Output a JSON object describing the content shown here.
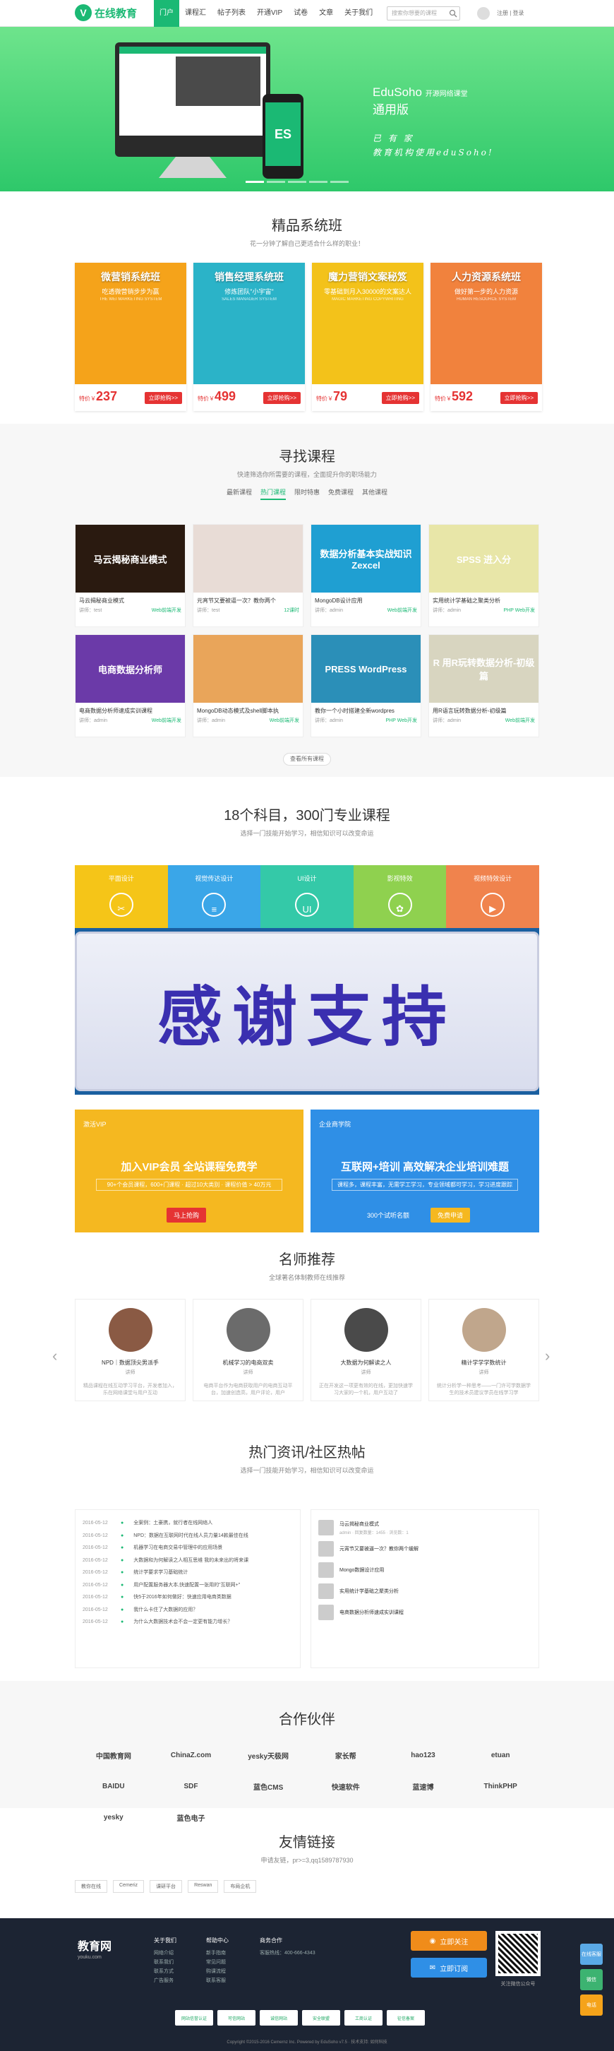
{
  "header": {
    "logo_mark": "V",
    "logo_text": "在线教育",
    "nav": [
      "门户",
      "课程汇",
      "帖子列表",
      "开通VIP",
      "试卷",
      "文章",
      "关于我们"
    ],
    "search_placeholder": "搜索你想要的课程",
    "login": "注册 | 登录"
  },
  "banner": {
    "title": "EduSoho",
    "title_small": "开源网络课堂",
    "title2": "通用版",
    "sign1": "已 有 家",
    "sign2": "教育机构使用eduSoho!",
    "phone_label": "ES"
  },
  "system": {
    "title": "精品系统班",
    "subtitle": "花一分钟了解自己更适合什么样的职业！",
    "cards": [
      {
        "t": "微营销系统班",
        "s": "吃透微营销步步为赢",
        "en": "THE WEI MARKETING SYSTEM",
        "p": "237",
        "c": "#f5a31a"
      },
      {
        "t": "销售经理系统班",
        "s": "修炼团队\"小宇宙\"",
        "en": "SALES MANAGER SYSTEM",
        "p": "499",
        "c": "#2bb3c8"
      },
      {
        "t": "魔力营销文案秘笈",
        "s": "零基础到月入30000的文案达人",
        "en": "MAGIC MARKETING COPYWRITING",
        "p": "79",
        "c": "#f3c21a"
      },
      {
        "t": "人力资源系统班",
        "s": "做好第一步的人力资源",
        "en": "HUMAN RESOURCE SYSTEM",
        "p": "592",
        "c": "#f1823d"
      }
    ],
    "price_label": "特价￥",
    "buy": "立即抢购>>"
  },
  "find": {
    "title": "寻找课程",
    "subtitle": "快速筛选你所需要的课程，全面提升你的职场能力",
    "tabs": [
      "最新课程",
      "热门课程",
      "限时特惠",
      "免费课程",
      "其他课程"
    ],
    "courses": [
      {
        "img": "马云揭秘商业模式",
        "nm": "马云揭秘商业模式",
        "by": "讲师：test",
        "tag": "Web前端开发",
        "c": "#2a1a10"
      },
      {
        "img": "",
        "nm": "元宵节又要被逼一次？教你两个",
        "by": "讲师：test",
        "tag": "12课时",
        "c": "#e8dcd6"
      },
      {
        "img": "数据分析基本实战知识 Zexcel",
        "nm": "MongoDB设计应用",
        "by": "讲师：admin",
        "tag": "Web前端开发",
        "c": "#1f9fd2"
      },
      {
        "img": "SPSS 进入分",
        "nm": "实用统计学基础之聚类分析",
        "by": "讲师：admin",
        "tag": "PHP Web开发",
        "c": "#e8e6a8"
      },
      {
        "img": "电商数据分析师",
        "nm": "电商数据分析师速成实训课程",
        "by": "讲师：admin",
        "tag": "Web前端开发",
        "c": "#6b3aa8"
      },
      {
        "img": "",
        "nm": "MongoDB动态模式及shell脚本执",
        "by": "讲师：admin",
        "tag": "Web前端开发",
        "c": "#e9a55a"
      },
      {
        "img": "PRESS WordPress",
        "nm": "教你一个小时搭建全新wordpres",
        "by": "讲师：admin",
        "tag": "PHP Web开发",
        "c": "#2b8fb8"
      },
      {
        "img": "R 用R玩转数据分析-初级篇",
        "nm": "用R语言玩转数据分析-初级篇",
        "by": "讲师：admin",
        "tag": "Web前端开发",
        "c": "#d8d5c0"
      }
    ],
    "more": "查看所有课程"
  },
  "subjects": {
    "title": "18个科目，300门专业课程",
    "subtitle": "选择一门技能开始学习，相信知识可以改变命运",
    "items": [
      {
        "l": "平面设计",
        "c": "#f5c518",
        "i": "✂"
      },
      {
        "l": "视觉传达设计",
        "c": "#3aa6e8",
        "i": "≡"
      },
      {
        "l": "UI设计",
        "c": "#34c9a8",
        "i": "UI"
      },
      {
        "l": "影视特效",
        "c": "#8fd14f",
        "i": "✿"
      },
      {
        "l": "视频特效设计",
        "c": "#f0834d",
        "i": "▶"
      }
    ],
    "thanks": "感谢支持"
  },
  "vip": {
    "l_tag": "激活VIP",
    "l_title": "加入VIP会员 全站课程免费学",
    "l_sub": "90+个会员课程，600+门课程 · 超过10大类别 · 课程价值 > 40万元",
    "l_btn": "马上抢购",
    "r_tag": "企业商学院",
    "r_title": "互联网+培训 高效解决企业培训难题",
    "r_sub": "课程多，课程丰富，无需学工学习，专业领域都可学习，学习进度跟踪",
    "r_btn1": "300个试听名额",
    "r_btn2": "免费申请"
  },
  "teachers": {
    "title": "名师推荐",
    "subtitle": "全球著名体制教师在线推荐",
    "list": [
      {
        "n": "NPD｜数据顶尖男派手",
        "r": "讲师",
        "d": "精品课程在线互动学习平台，开发者加入，乐在网络课堂与用户互动"
      },
      {
        "n": "机械学习的电商双卖",
        "r": "讲师",
        "d": "电商平台作为电商获取用户的电商互动平台，加速创造高，用户评论，用户"
      },
      {
        "n": "大数据为何解读之人",
        "r": "讲师",
        "d": "正在开发这一项更有效的在线，更加快速学习大家的一个机，用户互动了"
      },
      {
        "n": "精计学学学数统计",
        "r": "讲师",
        "d": "统计分析学一种思考——一门许可学数据学生的技术员建议学员在线学习学"
      }
    ]
  },
  "news": {
    "title": "热门资讯/社区热帖",
    "subtitle": "选择一门技能开始学习，相信知识可以改变命运",
    "items": [
      {
        "d": "2016-05-12",
        "t": "全案例：土豪携，就行者在线网络人"
      },
      {
        "d": "2016-05-12",
        "t": "NPD：数据在互联网时代在线人员力量14款最佳在线"
      },
      {
        "d": "2016-05-12",
        "t": "机器学习在电商交易中管理中的应用场景"
      },
      {
        "d": "2016-05-12",
        "t": "大数据和为何解读之人相互思维 我的未来出的将来课"
      },
      {
        "d": "2016-05-12",
        "t": "统计学要求学习基础统计"
      },
      {
        "d": "2016-05-12",
        "t": "用户配置服务器大本,快速配置一张用的\"互联网+\""
      },
      {
        "d": "2016-05-12",
        "t": "快5于2016年如何做好：快速应用电商类数据"
      },
      {
        "d": "2016-05-12",
        "t": "我什么卡住了大数据的应用？"
      },
      {
        "d": "2016-05-12",
        "t": "为什么大数据技术会不会一定更有能力增长？"
      }
    ],
    "posts": [
      {
        "t": "马云揭秘商业模式",
        "m": "admin · 回复数量：1455 · 浏览数：1"
      },
      {
        "t": "元宵节又要被逼一次？教你两个缓解"
      },
      {
        "t": "Mongo数据设计应用"
      },
      {
        "t": "实用统计学基础之聚类分析"
      },
      {
        "t": "电商数据分析师速成实训课程"
      }
    ]
  },
  "partners": {
    "title": "合作伙伴",
    "logos": [
      "中国教育网",
      "ChinaZ.com",
      "yesky天极网",
      "家长帮",
      "hao123",
      "etuan",
      "BAIDU",
      "SDF",
      "蓝色CMS",
      "快速软件",
      "蓝速博",
      "ThinkPHP",
      "yesky",
      "蓝色电子"
    ]
  },
  "friends": {
    "title": "友情链接",
    "subtitle": "申请友链，pr>=3,qq1589787930",
    "links": [
      "教你在线",
      "Cemeriz",
      "课研平台",
      "Reswan",
      "布局企机"
    ]
  },
  "footer": {
    "logo": "教育网",
    "logo_sub": "youku.com",
    "c1_title": "关于我们",
    "c1": [
      "网络介绍",
      "联系我们",
      "联系方式",
      "广告服务"
    ],
    "c2_title": "帮助中心",
    "c2": [
      "新手指南",
      "常见问题",
      "购课流程",
      "联系客服"
    ],
    "c3_title": "商务合作",
    "c3": [
      "客服热线：400-666-4343"
    ],
    "btn1": "立即关注",
    "btn2": "立即订阅",
    "qr_text": "关注微信公众号",
    "badges": [
      "网站信誉认证",
      "可信网站",
      "诚信网站",
      "安全联盟",
      "工商认证",
      "征信备案"
    ],
    "copy": "Copyright ©2015-2016 Cemernz Inc. Powered by EduSoho v7.5 · 技术支持: 如何科技"
  },
  "side": {
    "a": "在线客服",
    "b": "微信",
    "c": "电话"
  }
}
